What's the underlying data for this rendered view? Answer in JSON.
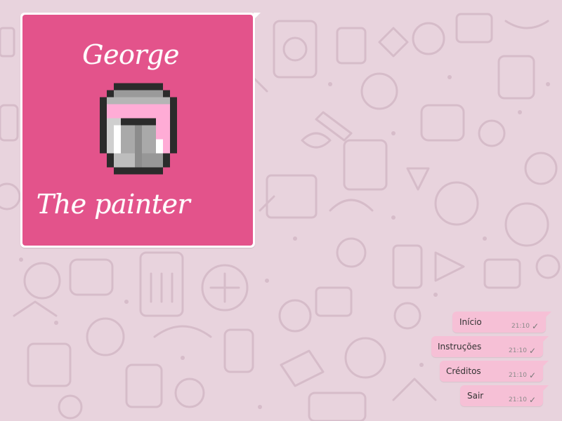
{
  "title_card": {
    "line1": "George",
    "line2": "The painter",
    "icon": "paint-bucket-icon",
    "background": "#e3538b"
  },
  "menu": {
    "items": [
      {
        "label": "Início",
        "time": "21:10",
        "status_icon": "check-icon"
      },
      {
        "label": "Instruções",
        "time": "21:10",
        "status_icon": "check-icon"
      },
      {
        "label": "Créditos",
        "time": "21:10",
        "status_icon": "check-icon"
      },
      {
        "label": "Sair",
        "time": "21:10",
        "status_icon": "check-icon"
      }
    ],
    "bubble_color": "#f6c0d6"
  },
  "wallpaper_color": "#e8d3dd"
}
